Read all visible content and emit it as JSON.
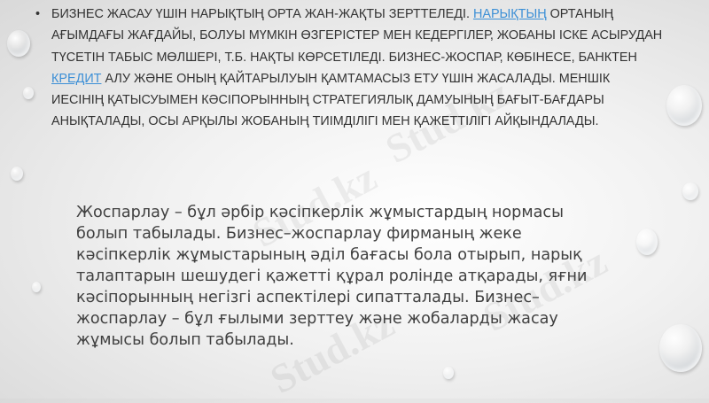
{
  "watermark": "Stud.kz",
  "bullet": {
    "dot": "•",
    "t1": "Бизнес жасау үшін нарықтың орта жан-жақты зерттеледі. ",
    "link1": "Нарықтың",
    "t2": " ортаның ағымдағы жағдайы, болуы мүмкін өзгерістер мен кедергілер, жобаны іске асырудан түсетін табыс мөлшері, т.б. нақты көрсетіледі. Бизнес-жоспар, көбінесе, банктен ",
    "link2": "кредит",
    "t3": " алу және оның қайтарылуын қамтамасыз ету үшін жасалады. Меншік иесінің қатысуымен кәсіпорынның стратегиялық дамуының бағыт-бағдары анықталады, осы арқылы жобаның тиімділігі мен қажеттілігі айқындалады."
  },
  "paragraph": "Жоспарлау – бұл әрбір кәсіпкерлік жұмыстардың нормасы болып табылады. Бизнес–жоспарлау фирманың жеке кәсіпкерлік жұмыстарының әділ бағасы бола отырып, нарық талаптарын шешудегі қажетті құрал ролінде атқарады, яғни кәсіпорынның негізгі аспектілері сипатталады. Бизнес–жоспарлау – бұл ғылыми зерттеу және жобаларды жасау жұмысы болып табылады."
}
